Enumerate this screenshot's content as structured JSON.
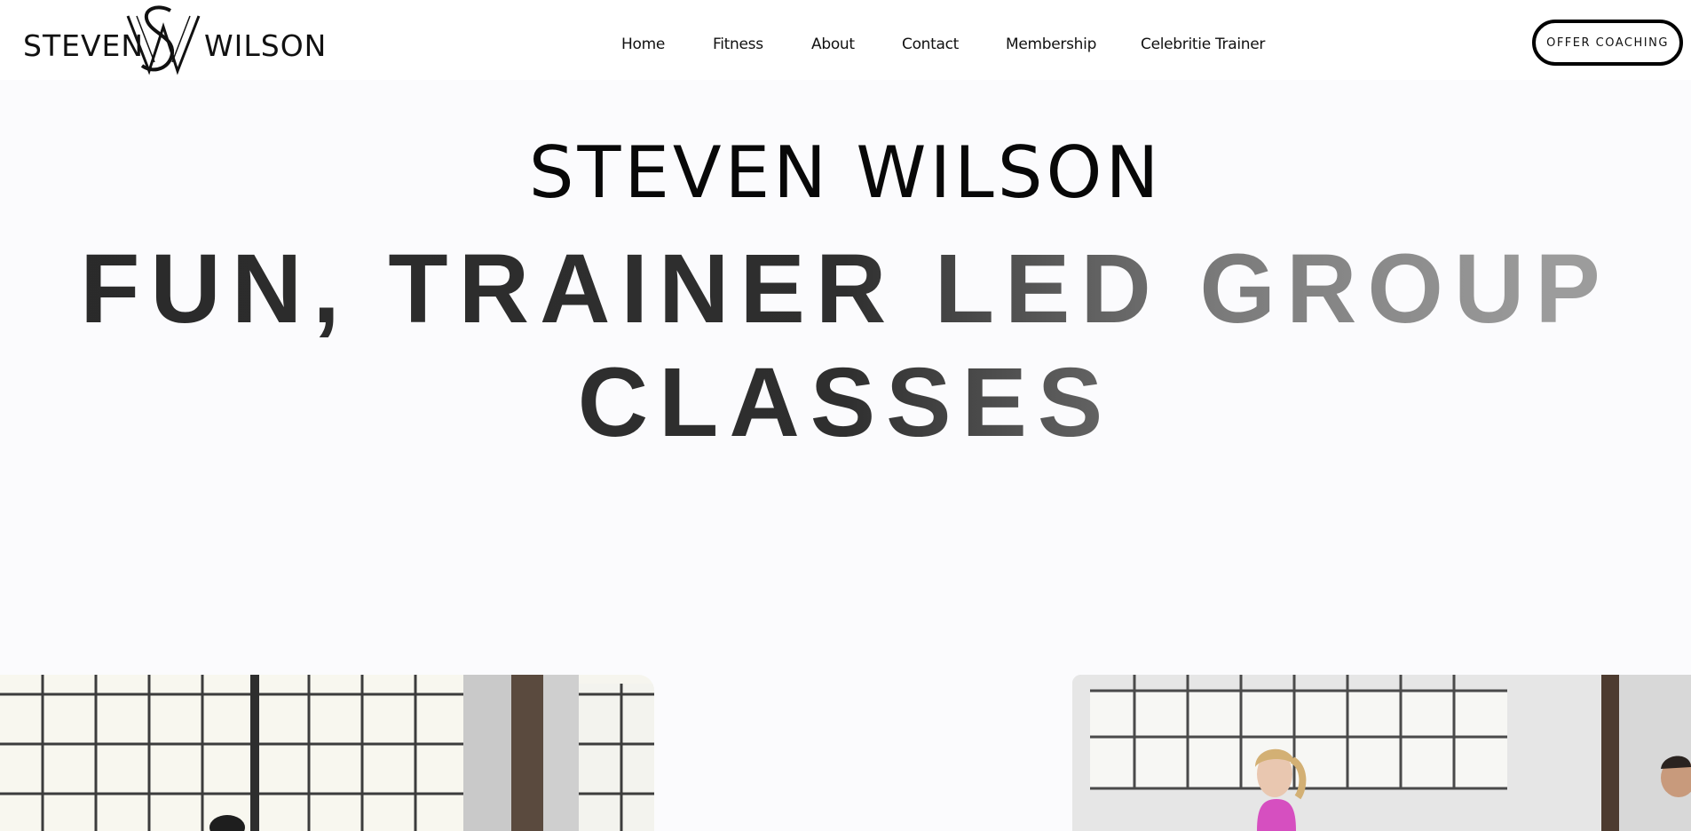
{
  "header": {
    "logo": {
      "word_left": "STEVEN",
      "word_right": "WILSON",
      "monogram": "SW"
    },
    "nav": [
      {
        "label": "Home"
      },
      {
        "label": "Fitness"
      },
      {
        "label": "About"
      },
      {
        "label": "Contact"
      },
      {
        "label": "Membership"
      },
      {
        "label": "Celebritie Trainer"
      }
    ],
    "cta_label": "OFFER COACHING"
  },
  "hero": {
    "name": "STEVEN WILSON",
    "title_line1": "FUN, TRAINER LED GROUP",
    "title_line2": "CLASSES"
  },
  "colors": {
    "page_background": "#fbfbfd",
    "header_background": "#ffffff",
    "text": "#111111"
  }
}
